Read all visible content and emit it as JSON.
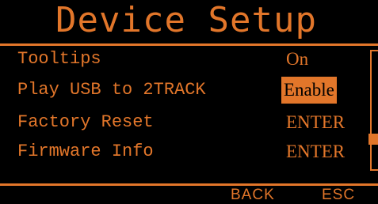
{
  "screen": {
    "title": "Device Setup",
    "accent_color": "#e2762a",
    "background_color": "#000000"
  },
  "menu": {
    "items": [
      {
        "label": "Tooltips",
        "value": "On",
        "selected": false
      },
      {
        "label": "Play USB to 2TRACK",
        "value": "Enable",
        "selected": true
      },
      {
        "label": "Factory Reset",
        "value": "ENTER",
        "selected": false
      },
      {
        "label": "Firmware Info",
        "value": "ENTER",
        "selected": false
      }
    ]
  },
  "footer": {
    "back_label": "BACK",
    "esc_label": "ESC"
  }
}
